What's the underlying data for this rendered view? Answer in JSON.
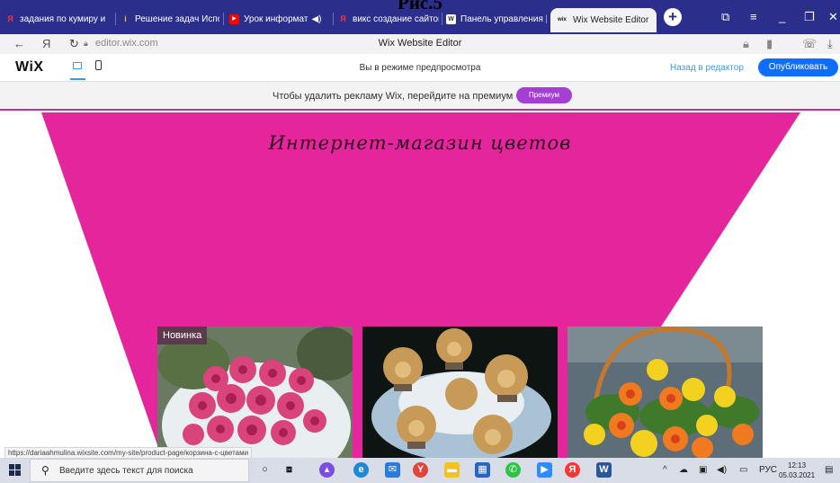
{
  "overlay_title": "Рис.5",
  "browser": {
    "tabs": [
      {
        "title": "задания по кумиру и",
        "favicon": "Я",
        "color": "#ff3333"
      },
      {
        "title": "Решение задач Испо",
        "favicon": "i",
        "color": "#f7c600"
      },
      {
        "title": "Урок информат",
        "favicon": "▶",
        "color": "#ff0000"
      },
      {
        "title": "викс создание сайтов",
        "favicon": "Я",
        "color": "#ff3333"
      },
      {
        "title": "Панель управления |",
        "favicon": "W",
        "color": "#ffffff"
      },
      {
        "title": "Wix Website Editor",
        "favicon": "wix",
        "color": "#111111"
      }
    ],
    "audio_icon": "🔈",
    "new_tab_label": "+",
    "url": "editor.wix.com",
    "page_title": "Wix Website Editor"
  },
  "wix": {
    "logo": "WiX",
    "preview_text": "Вы в режиме предпросмотра",
    "back_label": "Назад в редактор",
    "publish_label": "Опубликовать"
  },
  "banner": {
    "text": "Чтобы удалить рекламу Wix, перейдите на премиум",
    "button": "Премиум"
  },
  "site": {
    "heading": "Интернет-магазин цветов",
    "badge": "Новинка",
    "accent_color": "#e4259c"
  },
  "status_url": "https://dariaahmulina.wixsite.com/my-site/product-page/корзина-с-цветами",
  "taskbar": {
    "search_placeholder": "Введите здесь текст для поиска",
    "lang": "РУС",
    "time": "12:13",
    "date": "05.03.2021"
  }
}
